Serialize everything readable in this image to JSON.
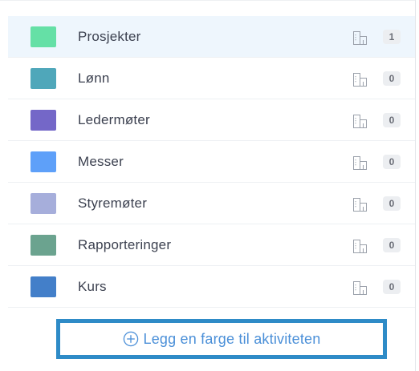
{
  "categories": [
    {
      "label": "Prosjekter",
      "color": "#65e0a6",
      "count": "1",
      "selected": true
    },
    {
      "label": "Lønn",
      "color": "#4fa7ba",
      "count": "0",
      "selected": false
    },
    {
      "label": "Ledermøter",
      "color": "#7467c8",
      "count": "0",
      "selected": false
    },
    {
      "label": "Messer",
      "color": "#5ea0f9",
      "count": "0",
      "selected": false
    },
    {
      "label": "Styremøter",
      "color": "#a6aedb",
      "count": "0",
      "selected": false
    },
    {
      "label": "Rapporteringer",
      "color": "#6ba38f",
      "count": "0",
      "selected": false
    },
    {
      "label": "Kurs",
      "color": "#437fc9",
      "count": "0",
      "selected": false
    }
  ],
  "icons": {
    "row_icon": "document-icon",
    "add_icon": "plus-circle-icon"
  },
  "add_button": {
    "label": "Legg en farge til aktiviteten"
  },
  "colors": {
    "accent": "#2e8bc7",
    "link": "#4a8fd8",
    "selected_row": "#eef6fd"
  }
}
